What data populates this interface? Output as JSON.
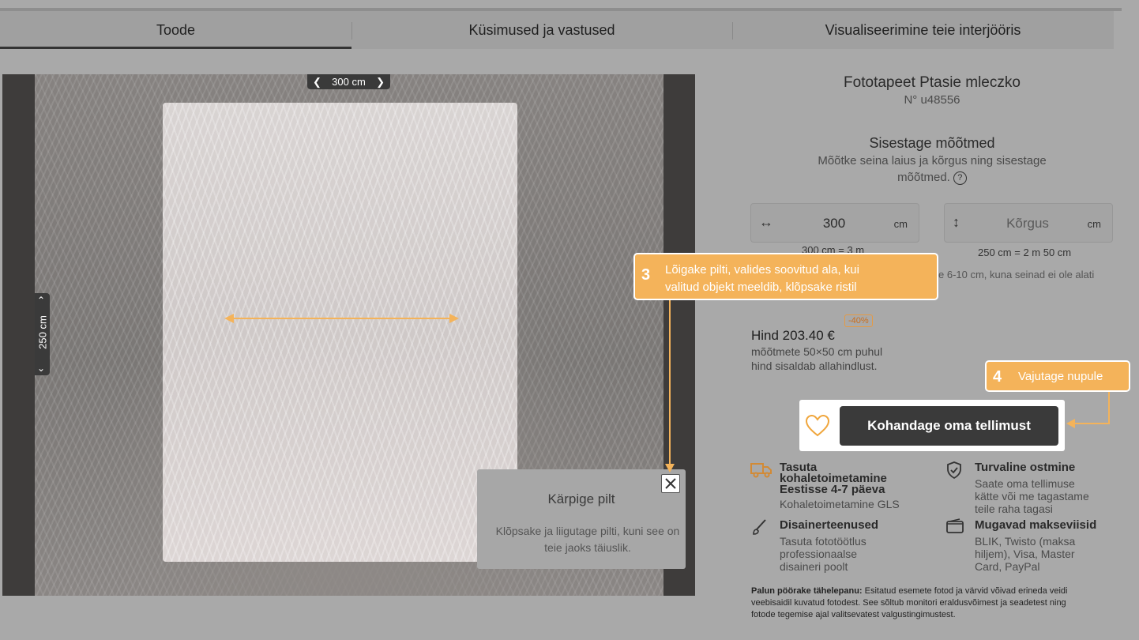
{
  "tabs": [
    {
      "label": "Toode"
    },
    {
      "label": "Küsimused ja vastused"
    },
    {
      "label": "Visualiseerimine teie interjööris"
    }
  ],
  "editor": {
    "width_label": "300 cm",
    "height_label": "250 cm",
    "popup_title": "Kärpige pilt",
    "popup_text": "Klõpsake ja liigutage pilti, kuni see on teie jaoks täiuslik."
  },
  "product": {
    "title": "Fototapeet Ptasie mleczko",
    "number": "N° u48556"
  },
  "measurements": {
    "title": "Sisestage mõõtmed",
    "description": "Mõõtke seina laius ja kõrgus ning sisestage mõõtmed.",
    "help_icon": "?",
    "width_value": "300",
    "width_unit": "cm",
    "width_sub": "300 cm = 3 m",
    "height_placeholder": "Kõrgus",
    "height_unit": "cm",
    "height_sub": "250 cm = 2 m 50 cm",
    "note": "e 6-10 cm, kuna seinad ei ole alati"
  },
  "callouts": {
    "step3_number": "3",
    "step3_text_line1": "Lõigake pilti, valides soovitud ala, kui",
    "step3_text_line2": "valitud objekt meeldib, klõpsake ristil",
    "step4_number": "4",
    "step4_text": "Vajutage nupule"
  },
  "price": {
    "label": "Hind 203.40 €",
    "discount": "-40%",
    "line1": "mõõtmete 50×50 cm puhul",
    "line2": "hind sisaldab allahindlust."
  },
  "cta": {
    "label": "Kohandage oma tellimust"
  },
  "features": [
    {
      "icon": "truck-icon",
      "title_line1": "Tasuta",
      "title_line2": "kohaletoimetamine",
      "title_line3": "Eestisse 4-7 päeva",
      "sub": "Kohaletoimetamine GLS"
    },
    {
      "icon": "shield-icon",
      "title_line1": "Turvaline ostmine",
      "sub_line1": "Saate oma tellimuse",
      "sub_line2": "kätte või me tagastame",
      "sub_line3": "teile raha tagasi"
    },
    {
      "icon": "brush-icon",
      "title_line1": "Disainerteenused",
      "sub_line1": "Tasuta fototöötlus",
      "sub_line2": "professionaalse",
      "sub_line3": "disaineri poolt"
    },
    {
      "icon": "wallet-icon",
      "title_line1": "Mugavad makseviisid",
      "sub_line1": "BLIK, Twisto (maksa",
      "sub_line2": "hiljem), Visa, Master",
      "sub_line3": "Card, PayPal"
    }
  ],
  "disclaimer": {
    "bold": "Palun pöörake tähelepanu:",
    "text": " Esitatud esemete fotod ja värvid võivad erineda veidi veebisaidil kuvatud fotodest. See sõltub monitori eraldusvõimest ja seadetest ning fotode tegemise ajal valitsevatest valgustingimustest."
  },
  "colors": {
    "accent": "#f4b35a",
    "cta_bg": "#3a3a3a",
    "overlay": "#a9a9a9"
  }
}
